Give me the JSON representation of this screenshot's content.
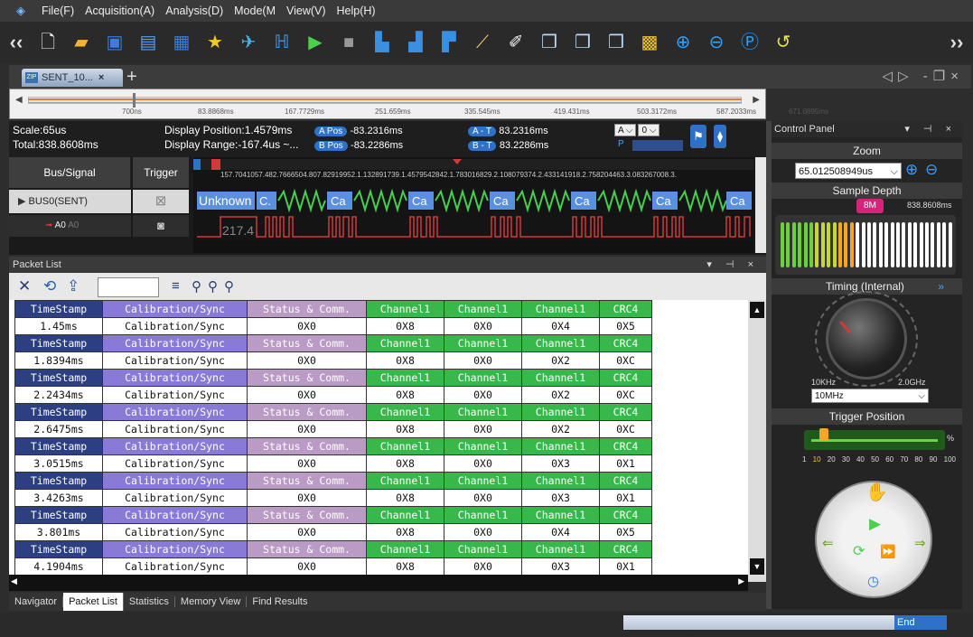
{
  "menu": {
    "items": [
      "File(F)",
      "Acquisition(A)",
      "Analysis(D)",
      "Mode(M",
      "View(V)",
      "Help(H)"
    ]
  },
  "doc_tab": {
    "label": "SENT_10..."
  },
  "overview": {
    "ticks": [
      "700ns",
      "83.8868ms",
      "167.7729ms",
      "251.659ms",
      "335.545ms",
      "419.431ms",
      "503.3172ms",
      "587.2033ms",
      "671.0895ms"
    ]
  },
  "info": {
    "scale": "Scale:65us",
    "total": "Total:838.8608ms",
    "display_position": "Display Position:1.4579ms",
    "display_range": "Display Range:-167.4us ~...",
    "a_pos_label": "A Pos",
    "a_pos_value": "-83.2316ms",
    "b_pos_label": "B Pos",
    "b_pos_value": "-83.2286ms",
    "a_minus_t_label": "A - T",
    "a_minus_t_value": "83.2316ms",
    "b_minus_t_label": "B - T",
    "b_minus_t_value": "83.2286ms",
    "sel_a": "A",
    "sel_0": "0",
    "p_label": "P"
  },
  "waveform": {
    "bus_signal_label": "Bus/Signal",
    "trigger_label": "Trigger",
    "bus0": "BUS0(SENT)",
    "a0": "A0",
    "a0_ghost": "A0",
    "ruler_text": "157.7041057.482.7666504.807.82919952.1.132891739.1.4579542842.1.783016829.2.108079374.2.433141918.2.758204463.3.083267008.3.",
    "decode_first": "Unknown",
    "decode_c": "C.",
    "decode_ca": "Ca",
    "analog_readout": "217.4"
  },
  "packet_list": {
    "title": "Packet List",
    "headers": [
      "TimeStamp",
      "Calibration/Sync",
      "Status & Comm.",
      "Channel1",
      "Channel1",
      "Channel1",
      "CRC4"
    ],
    "rows": [
      [
        "1.45ms",
        "Calibration/Sync",
        "0X0",
        "0X8",
        "0X0",
        "0X4",
        "0X5"
      ],
      [
        "1.8394ms",
        "Calibration/Sync",
        "0X0",
        "0X8",
        "0X0",
        "0X2",
        "0XC"
      ],
      [
        "2.2434ms",
        "Calibration/Sync",
        "0X0",
        "0X8",
        "0X0",
        "0X2",
        "0XC"
      ],
      [
        "2.6475ms",
        "Calibration/Sync",
        "0X0",
        "0X8",
        "0X0",
        "0X2",
        "0XC"
      ],
      [
        "3.0515ms",
        "Calibration/Sync",
        "0X0",
        "0X8",
        "0X0",
        "0X3",
        "0X1"
      ],
      [
        "3.4263ms",
        "Calibration/Sync",
        "0X0",
        "0X8",
        "0X0",
        "0X3",
        "0X1"
      ],
      [
        "3.801ms",
        "Calibration/Sync",
        "0X0",
        "0X8",
        "0X0",
        "0X4",
        "0X5"
      ],
      [
        "4.1904ms",
        "Calibration/Sync",
        "0X0",
        "0X8",
        "0X0",
        "0X3",
        "0X1"
      ]
    ]
  },
  "bottom_tabs": [
    "Navigator",
    "Packet List",
    "Statistics",
    "Memory View",
    "Find Results"
  ],
  "status": {
    "end": "End"
  },
  "control_panel": {
    "title": "Control Panel",
    "zoom_label": "Zoom",
    "zoom_value": "65.012508949us",
    "sample_depth_label": "Sample Depth",
    "sample_depth_marker": "8M",
    "sample_depth_total": "838.8608ms",
    "sample_depth_level": 0.42,
    "timing_label": "Timing (Internal)",
    "timing_min": "10KHz",
    "timing_max": "2.0GHz",
    "timing_value": "10MHz",
    "trigger_position_label": "Trigger Position",
    "trigger_percent": "%",
    "trigger_position_value": 10,
    "trigger_scale": [
      "1",
      "10",
      "20",
      "30",
      "40",
      "50",
      "60",
      "70",
      "80",
      "90",
      "100"
    ]
  },
  "colors": {
    "accent_blue": "#2e72c8",
    "signal_red": "#d23a3a",
    "decode_green": "#44d04f",
    "decode_blue": "#5b8fe0"
  }
}
